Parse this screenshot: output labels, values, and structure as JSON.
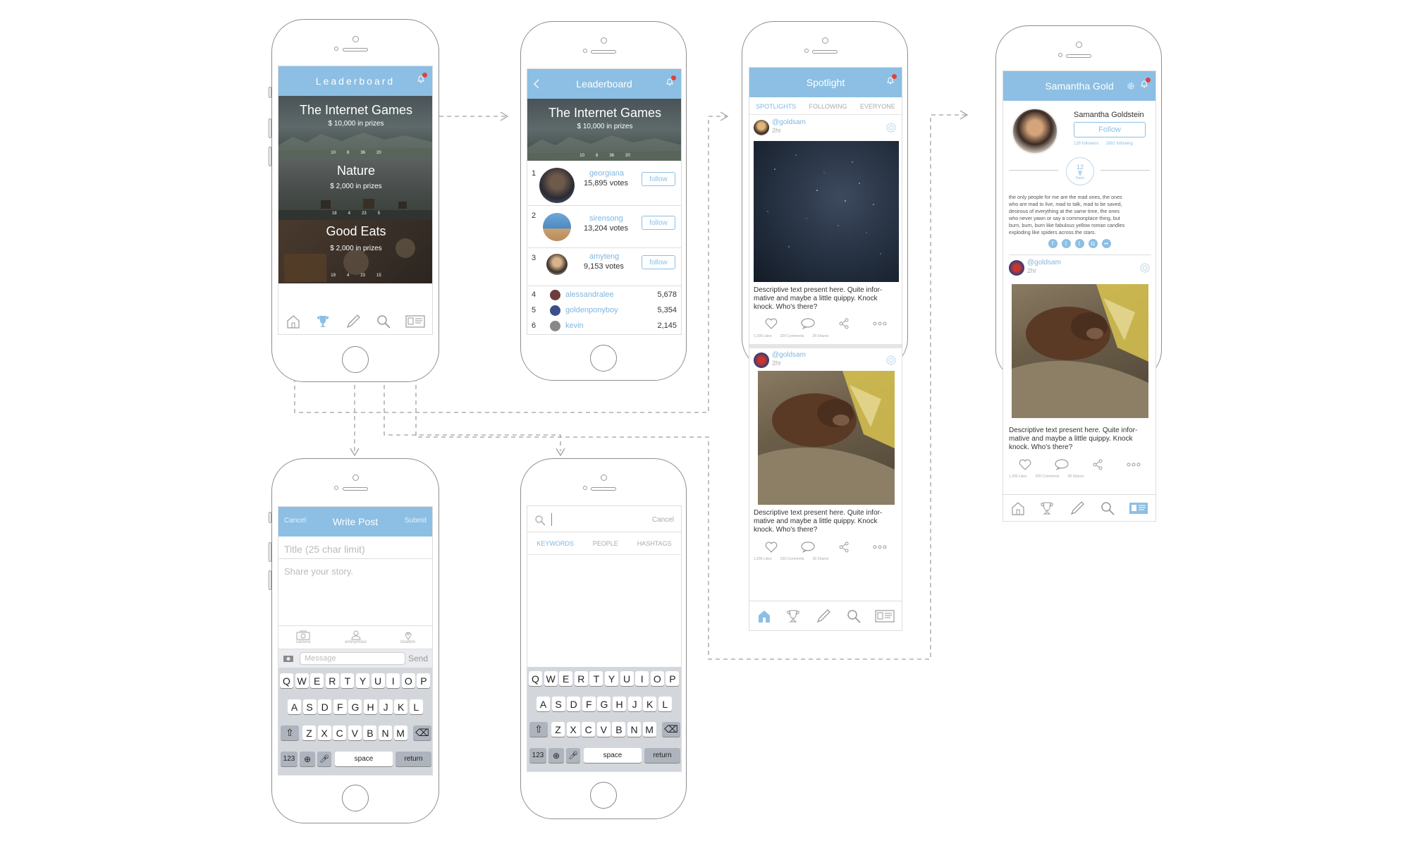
{
  "leaderboard_home": {
    "title": "Leaderboard",
    "contests": [
      {
        "name": "The Internet Games",
        "prize": "$ 10,000 in prizes",
        "stats": [
          "10",
          "8",
          "36",
          "20"
        ]
      },
      {
        "name": "Nature",
        "prize": "$ 2,000 in prizes",
        "stats": [
          "18",
          "4",
          "23",
          "5"
        ]
      },
      {
        "name": "Good Eats",
        "prize": "$ 2,000 in prizes",
        "stats": [
          "19",
          "4",
          "23",
          "15"
        ]
      }
    ]
  },
  "leaderboard_detail": {
    "title": "Leaderboard",
    "contest": {
      "name": "The Internet Games",
      "prize": "$ 10,000 in prizes",
      "stats": [
        "10",
        "8",
        "36",
        "20"
      ]
    },
    "top": [
      {
        "rank": "1",
        "user": "georgiana",
        "votes": "15,895 votes",
        "action": "follow"
      },
      {
        "rank": "2",
        "user": "sirensong",
        "votes": "13,204 votes",
        "action": "follow"
      },
      {
        "rank": "3",
        "user": "amyteng",
        "votes": "9,153 votes",
        "action": "follow"
      }
    ],
    "others": [
      {
        "rank": "4",
        "user": "alessandralee",
        "score": "5,678"
      },
      {
        "rank": "5",
        "user": "goldenponyboy",
        "score": "5,354"
      },
      {
        "rank": "6",
        "user": "kevin",
        "score": "2,145"
      }
    ]
  },
  "spotlight": {
    "title": "Spotlight",
    "tabs": [
      "SPOTLIGHTS",
      "FOLLOWING",
      "EVERYONE"
    ],
    "post1": {
      "user": "@goldsam",
      "time": "2hr",
      "desc": "Descriptive text present here. Quite infor-\nmative and maybe a little quippy. Knock\nknock. Who's there?",
      "stats": [
        "1,290 Likes",
        "320 Comments",
        "28 Shares"
      ]
    },
    "post2": {
      "user": "@goldsam",
      "time": "2hr",
      "desc": "Descriptive text present here. Quite infor-\nmative and maybe a little quippy. Knock\nknock. Who's there?",
      "stats": [
        "1,290 Likes",
        "320 Comments",
        "28 Shares"
      ]
    }
  },
  "profile": {
    "title": "Samantha Gold",
    "full_name": "Samantha Goldstein",
    "follow": "Follow",
    "followers": "128 followers",
    "following": "2892 following",
    "rank_num": "12",
    "rank_label": "Rank",
    "bio": "the only people for me are the mad ones, the ones\nwho are mad to live, mad to talk, mad to be saved,\ndesirous of everything at the same time, the ones\nwho never yawn or say a commonplace thing, but\nburn, burn, burn like fabulous yellow roman candles\nexploding like spiders across the stars.",
    "post": {
      "user": "@goldsam",
      "time": "2hr",
      "desc": "Descriptive text present here. Quite infor-\nmative and maybe a little quippy. Knock\nknock. Who's there?",
      "stats": [
        "1,290 Likes",
        "320 Comments",
        "28 Shares"
      ]
    }
  },
  "write_post": {
    "cancel": "Cancel",
    "title": "Write Post",
    "submit": "Submit",
    "title_placeholder": "Title (25 char limit)",
    "body_placeholder": "Share your story.",
    "tools": [
      "camera",
      "anonymous",
      "location"
    ],
    "message_placeholder": "Message",
    "send": "Send"
  },
  "search": {
    "cancel": "Cancel",
    "tabs": [
      "KEYWORDS",
      "PEOPLE",
      "HASHTAGS"
    ]
  },
  "keyboard": {
    "row1": [
      "Q",
      "W",
      "E",
      "R",
      "T",
      "Y",
      "U",
      "I",
      "O",
      "P"
    ],
    "row2": [
      "A",
      "S",
      "D",
      "F",
      "G",
      "H",
      "J",
      "K",
      "L"
    ],
    "row3": [
      "Z",
      "X",
      "C",
      "V",
      "B",
      "N",
      "M"
    ],
    "num": "123",
    "space": "space",
    "return": "return"
  },
  "colors": {
    "accent": "#8cbfe3",
    "link": "#7fb6e0",
    "badge": "#e0413e",
    "connector": "#999999"
  }
}
